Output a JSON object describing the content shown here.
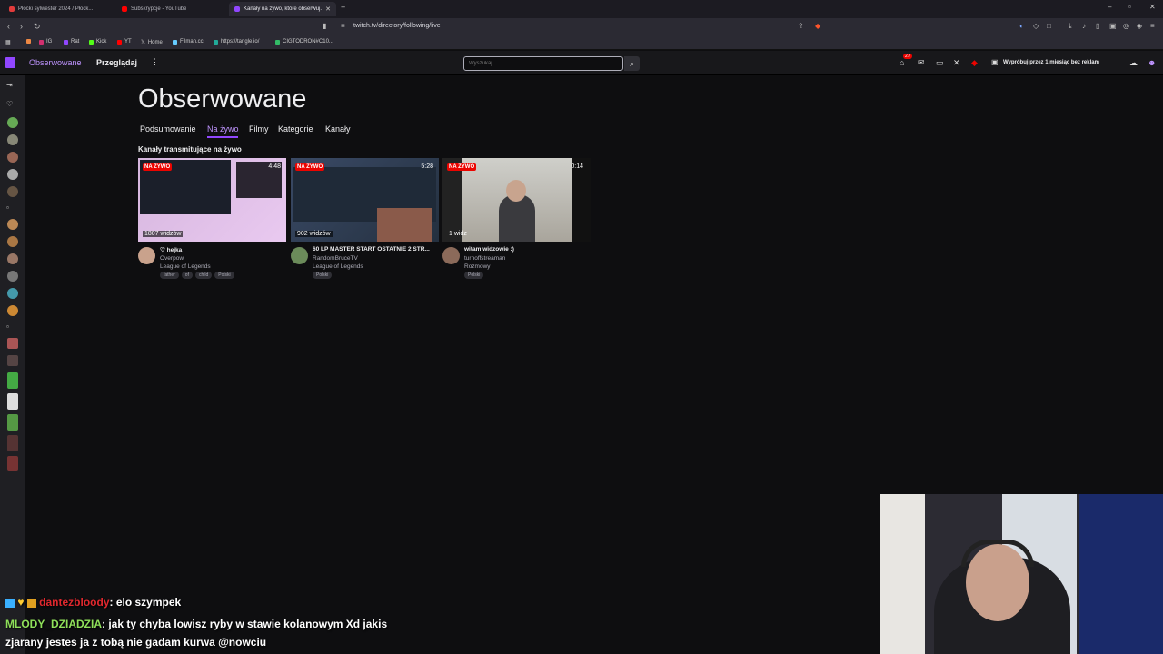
{
  "browser": {
    "tabs": [
      {
        "label": "Płocki sylwester 2024 / Płock...",
        "color": "#e23b3b"
      },
      {
        "label": "Subskrypcje - YouTube",
        "color": "#ff0000"
      },
      {
        "label": "Kanały na żywo, które obserwuj...",
        "color": "#9147ff"
      }
    ],
    "url": "twitch.tv/directory/following/live",
    "bookmarks": [
      "IG",
      "Rat",
      "Kick",
      "YT",
      "Home",
      "Filman.cc",
      "https://tangle.io/",
      "CIGTODRON#C10..."
    ]
  },
  "topnav": {
    "following": "Obserwowane",
    "browse": "Przeglądaj",
    "search_placeholder": "Wyszukaj",
    "notification_count": "27",
    "promo": "Wypróbuj przez 1 miesiąc bez reklam"
  },
  "page": {
    "title": "Obserwowane",
    "tabs": [
      "Podsumowanie",
      "Na żywo",
      "Filmy",
      "Kategorie",
      "Kanały"
    ],
    "active_tab": "Na żywo",
    "section_heading": "Kanały transmitujące na żywo"
  },
  "streams": [
    {
      "live_label": "NA ŻYWO",
      "time": "4:48",
      "viewers": "1807 widzów",
      "title": "♡ hejka",
      "channel": "Overpow",
      "category": "League of Legends",
      "tags": [
        "father",
        "of",
        "child",
        "Polski"
      ],
      "avatar_color": "#c9a28c"
    },
    {
      "live_label": "NA ŻYWO",
      "time": "5:28",
      "viewers": "902 widzów",
      "title": "60 LP MASTER START OSTATNIE 2 STR...",
      "channel": "RandomBruceTV",
      "category": "League of Legends",
      "tags": [
        "Polski"
      ],
      "avatar_color": "#6b8b5a"
    },
    {
      "live_label": "NA ŻYWO",
      "time": "0:14",
      "viewers": "1 widz",
      "title": "witam widzowie :)",
      "channel": "turnoffstreaman",
      "category": "Rozmowy",
      "tags": [
        "Polski"
      ],
      "avatar_color": "#8b6a5a"
    }
  ],
  "overlay_chat": [
    {
      "user": "dantezbloody",
      "text": ": elo szympek",
      "user_color": "#e0282e"
    },
    {
      "user": "MLODY_DZIADZIA",
      "text": ": jak ty chyba lowisz ryby w stawie kolanowym Xd jakis",
      "user_color": "#8fe05a"
    },
    {
      "user": "",
      "text": "zjarany jestes ja z tobą nie gadam kurwa @nowciu",
      "user_color": "#ffffff"
    }
  ]
}
